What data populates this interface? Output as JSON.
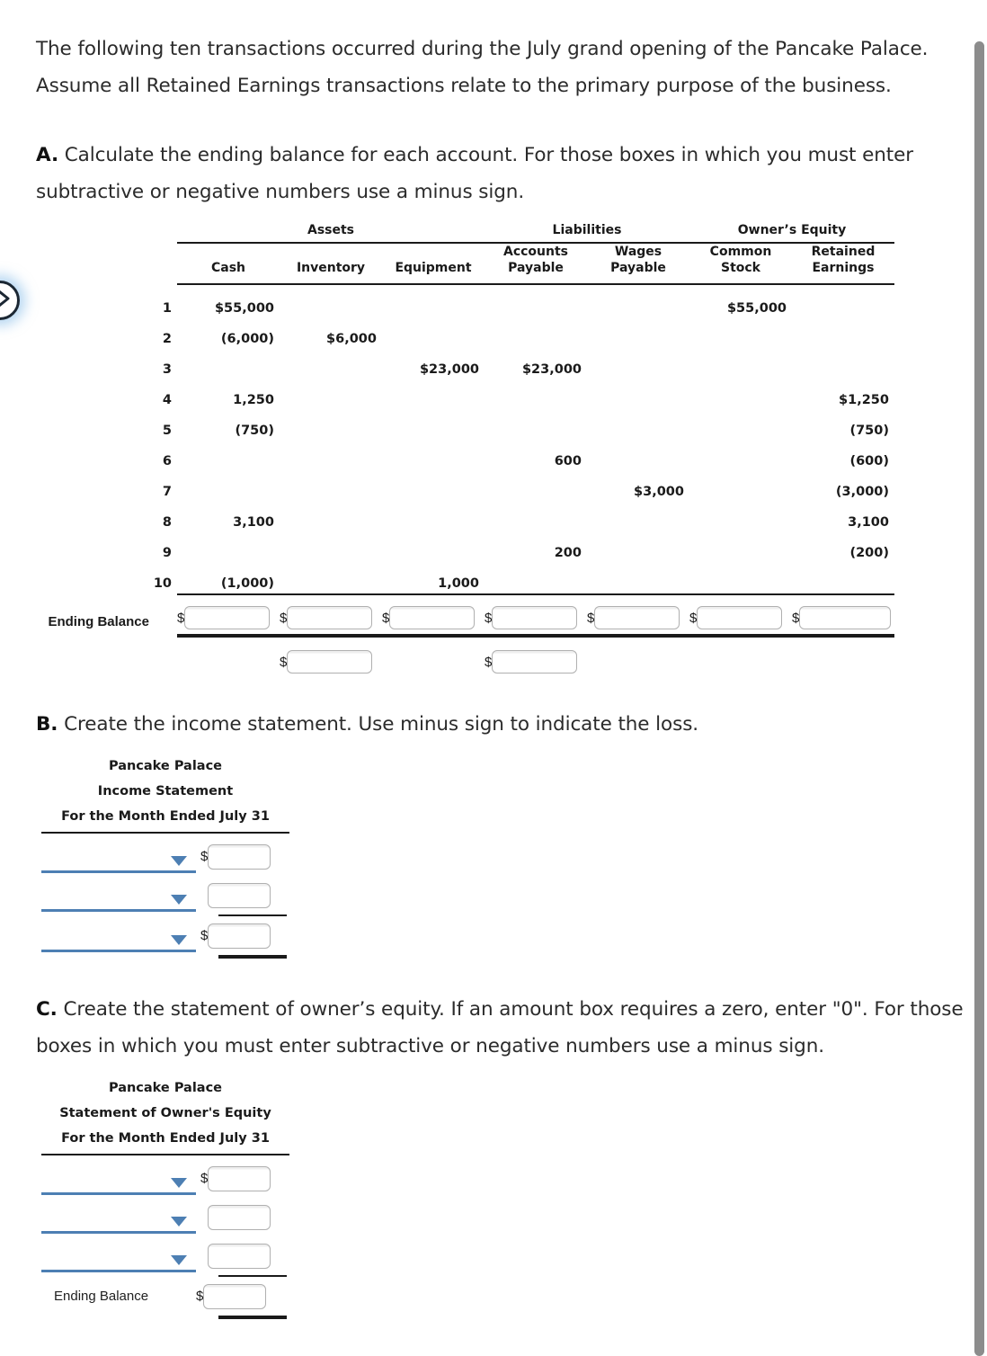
{
  "intro": {
    "paragraph": "The following ten transactions occurred during the July grand opening of the Pancake Palace. Assume all Retained Earnings transactions relate to the primary purpose of the business."
  },
  "parts": {
    "a": {
      "letter": "A.",
      "text": "Calculate the ending balance for each account. For those boxes in which you must enter subtractive or negative numbers use a minus sign."
    },
    "b": {
      "letter": "B.",
      "text": "Create the income statement. Use minus sign to indicate the loss."
    },
    "c": {
      "letter": "C.",
      "text": "Create the statement of owner’s equity. If an amount box requires a zero, enter \"0\". For those boxes in which you must enter subtractive or negative numbers use a minus sign."
    }
  },
  "worksheet": {
    "group_headers": [
      "Assets",
      "Liabilities",
      "Owner’s Equity"
    ],
    "column_headers": [
      {
        "line1": "",
        "line2": "Cash"
      },
      {
        "line1": "",
        "line2": "Inventory"
      },
      {
        "line1": "",
        "line2": "Equipment"
      },
      {
        "line1": "Accounts",
        "line2": "Payable"
      },
      {
        "line1": "Wages",
        "line2": "Payable"
      },
      {
        "line1": "Common",
        "line2": "Stock"
      },
      {
        "line1": "Retained",
        "line2": "Earnings"
      }
    ],
    "ending_balance_label": "Ending Balance",
    "currency_symbol": "$",
    "rows": [
      {
        "num": "1",
        "cash": "$55,000",
        "inventory": "",
        "equipment": "",
        "ap": "",
        "wp": "",
        "cs": "$55,000",
        "re": ""
      },
      {
        "num": "2",
        "cash": "(6,000)",
        "inventory": "$6,000",
        "equipment": "",
        "ap": "",
        "wp": "",
        "cs": "",
        "re": ""
      },
      {
        "num": "3",
        "cash": "",
        "inventory": "",
        "equipment": "$23,000",
        "ap": "$23,000",
        "wp": "",
        "cs": "",
        "re": ""
      },
      {
        "num": "4",
        "cash": "1,250",
        "inventory": "",
        "equipment": "",
        "ap": "",
        "wp": "",
        "cs": "",
        "re": "$1,250"
      },
      {
        "num": "5",
        "cash": "(750)",
        "inventory": "",
        "equipment": "",
        "ap": "",
        "wp": "",
        "cs": "",
        "re": "(750)"
      },
      {
        "num": "6",
        "cash": "",
        "inventory": "",
        "equipment": "",
        "ap": "600",
        "wp": "",
        "cs": "",
        "re": "(600)"
      },
      {
        "num": "7",
        "cash": "",
        "inventory": "",
        "equipment": "",
        "ap": "",
        "wp": "$3,000",
        "cs": "",
        "re": "(3,000)"
      },
      {
        "num": "8",
        "cash": "3,100",
        "inventory": "",
        "equipment": "",
        "ap": "",
        "wp": "",
        "cs": "",
        "re": "3,100"
      },
      {
        "num": "9",
        "cash": "",
        "inventory": "",
        "equipment": "",
        "ap": "200",
        "wp": "",
        "cs": "",
        "re": "(200)"
      },
      {
        "num": "10",
        "cash": "(1,000)",
        "inventory": "",
        "equipment": "1,000",
        "ap": "",
        "wp": "",
        "cs": "",
        "re": ""
      }
    ],
    "ending_balance_inputs": [
      "",
      "",
      "",
      "",
      "",
      "",
      ""
    ],
    "sub_inputs": [
      "",
      ""
    ]
  },
  "income_statement": {
    "title_line1": "Pancake Palace",
    "title_line2": "Income Statement",
    "title_line3": "For the Month Ended July 31",
    "currency_symbol": "$",
    "rows": [
      {
        "select_value": "",
        "amount": "",
        "show_dollar": true
      },
      {
        "select_value": "",
        "amount": "",
        "show_dollar": false
      },
      {
        "select_value": "",
        "amount": "",
        "show_dollar": true
      }
    ]
  },
  "owners_equity_statement": {
    "title_line1": "Pancake Palace",
    "title_line2": "Statement of Owner's Equity",
    "title_line3": "For the Month Ended July 31",
    "currency_symbol": "$",
    "ending_balance_label": "Ending Balance",
    "rows": [
      {
        "select_value": "",
        "amount": "",
        "show_dollar": true
      },
      {
        "select_value": "",
        "amount": "",
        "show_dollar": false
      },
      {
        "select_value": "",
        "amount": "",
        "show_dollar": false
      }
    ],
    "ending_balance_amount": ""
  },
  "controls": {
    "prev_arrow_icon": "chevron-right-icon",
    "scrollbar": "vertical-scrollbar"
  },
  "colors": {
    "accent_blue": "#4d7fb3",
    "rule_black": "#1a1a1a",
    "scrollbar_gray": "#8c8c8c",
    "input_border": "#b0b0b0"
  }
}
